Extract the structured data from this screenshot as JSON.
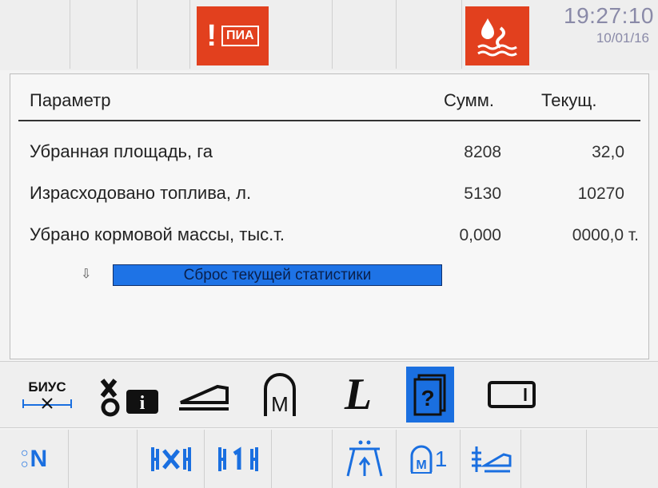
{
  "status_bar": {
    "alarm_left_label": "ПИА",
    "alarm_left_mark": "!",
    "time": "19:27:10",
    "date": "10/01/16"
  },
  "table": {
    "headers": [
      "Параметр",
      "Сумм.",
      "Текущ."
    ],
    "rows": [
      {
        "label": "Убранная площадь, га",
        "total": "8208",
        "current": "32,0"
      },
      {
        "label": "Израсходовано топлива, л.",
        "total": "5130",
        "current": "10270"
      },
      {
        "label": "Убрано кормовой массы, тыс.т.",
        "total": "0,000",
        "current": "0000,0 т."
      }
    ]
  },
  "reset_button": {
    "label": "Сброс текущей статистики"
  },
  "tabs": {
    "biuc_label": "БИУС",
    "items": [
      "biuc-icon",
      "harvester-info-icon",
      "header-icon",
      "m-icon",
      "l-icon",
      "help-book-icon",
      "screen-icon"
    ],
    "active_index": 5
  },
  "bottom_bar": {
    "items": [
      "neutral-n-icon",
      "",
      "chopper-x-icon",
      "chopper-1-icon",
      "",
      "header-lift-icon",
      "mode-1-icon",
      "header-float-icon",
      "",
      ""
    ],
    "n_label": "N",
    "m1_label": "1"
  },
  "colors": {
    "accent": "#1a6fe0",
    "alarm": "#e2401e"
  }
}
